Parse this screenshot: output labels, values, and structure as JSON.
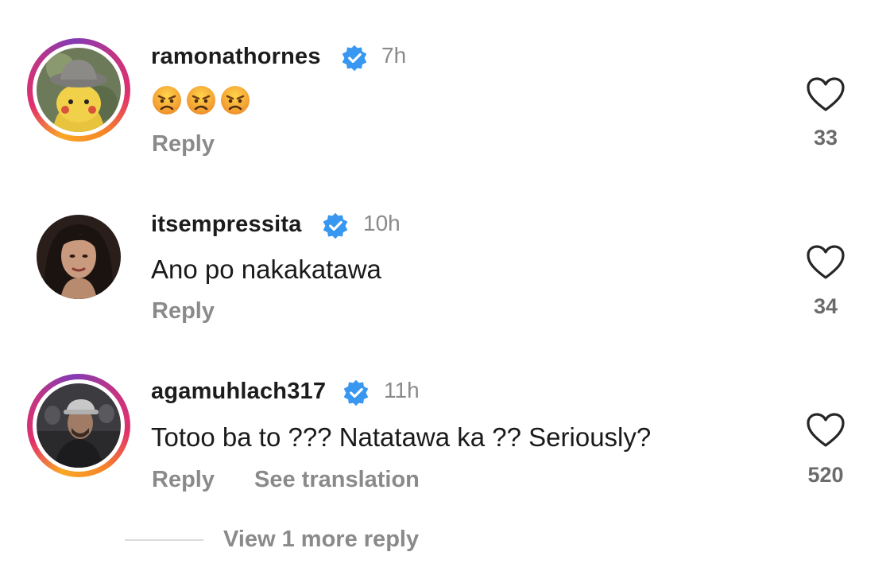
{
  "comments": [
    {
      "username": "ramonathornes",
      "verified": true,
      "time": "7h",
      "text": "",
      "emojis": [
        "angry-face-emoji",
        "angry-face-emoji",
        "angry-face-emoji"
      ],
      "reply_label": "Reply",
      "likes": "33",
      "story_ring": true
    },
    {
      "username": "itsempressita",
      "verified": true,
      "time": "10h",
      "text": "Ano po nakakatawa",
      "reply_label": "Reply",
      "likes": "34",
      "story_ring": false
    },
    {
      "username": "agamuhlach317",
      "verified": true,
      "time": "11h",
      "text": "Totoo ba to ??? Natatawa ka ?? Seriously?",
      "reply_label": "Reply",
      "translate_label": "See translation",
      "likes": "520",
      "story_ring": true
    }
  ],
  "view_more_label": "View 1 more reply",
  "colors": {
    "verified_blue": "#3897f0",
    "muted_text": "#8a8a8a",
    "story_ring": [
      "#f9a825",
      "#e1306c",
      "#833ab4"
    ]
  },
  "icons": {
    "like": "heart-outline-icon",
    "verified": "verified-badge-icon"
  }
}
